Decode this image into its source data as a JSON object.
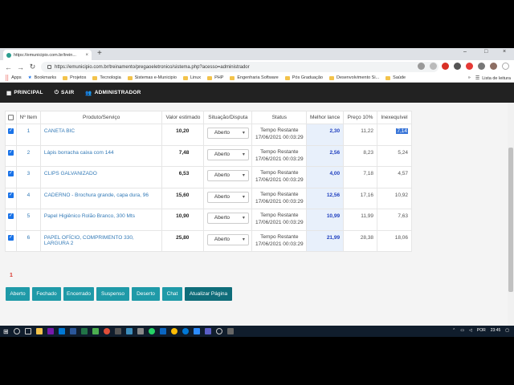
{
  "browser": {
    "tab_title": "https://emunicipio.com.br/trein...",
    "tab_close": "×",
    "new_tab": "+",
    "win_min": "–",
    "win_max": "□",
    "win_close": "×",
    "url": "https://emunicipio.com.br/treinamento/pregaoeletronico/sistema.php?acesso=administrador"
  },
  "bookmarks": {
    "items": [
      "Apps",
      "Bookmarks",
      "Projetos",
      "Tecnologia",
      "Sistemas e-Municipio",
      "Linux",
      "PHP",
      "Engenharia Software",
      "Pós Graduação",
      "Desenvolvimento Si...",
      "Saúde"
    ],
    "more": "»",
    "reading_list": "Lista de leitura"
  },
  "nav": {
    "principal": "PRINCIPAL",
    "sair": "SAIR",
    "administrador": "ADMINISTRADOR"
  },
  "table": {
    "headers": [
      "",
      "Nº Item",
      "Produto/Serviço",
      "Valor estimado",
      "Situação/Disputa",
      "Status",
      "Melhor lance",
      "Preço 10%",
      "Inexequível"
    ],
    "rows": [
      {
        "checked": true,
        "item": "1",
        "produto": "CANETA BIC",
        "valor": "10,20",
        "situacao": "Aberto",
        "status1": "Tempo Restante",
        "status2": "17/06/2021 00:03:29",
        "melhor": "2,30",
        "preco": "11,22",
        "inexeq": "7,14"
      },
      {
        "checked": true,
        "item": "2",
        "produto": "Lápis borracha caixa com 144",
        "valor": "7,48",
        "situacao": "Aberto",
        "status1": "Tempo Restante",
        "status2": "17/06/2021 00:03:29",
        "melhor": "2,56",
        "preco": "8,23",
        "inexeq": "5,24"
      },
      {
        "checked": true,
        "item": "3",
        "produto": "CLIPS GALVANIZADO",
        "valor": "6,53",
        "situacao": "Aberto",
        "status1": "Tempo Restante",
        "status2": "17/06/2021 00:03:29",
        "melhor": "4,00",
        "preco": "7,18",
        "inexeq": "4,57"
      },
      {
        "checked": true,
        "item": "4",
        "produto": "CADERNO - Brochura grande, capa dura, 96",
        "valor": "15,60",
        "situacao": "Aberto",
        "status1": "Tempo Restante",
        "status2": "17/06/2021 00:03:29",
        "melhor": "12,56",
        "preco": "17,16",
        "inexeq": "10,92"
      },
      {
        "checked": true,
        "item": "5",
        "produto": "Papel Higiênico Rolão Branco, 300 Mts",
        "valor": "10,90",
        "situacao": "Aberto",
        "status1": "Tempo Restante",
        "status2": "17/06/2021 00:03:29",
        "melhor": "10,99",
        "preco": "11,99",
        "inexeq": "7,63"
      },
      {
        "checked": true,
        "item": "6",
        "produto": "PAPEL OFÍCIO, COMPRIMENTO 330, LARGURA 2",
        "valor": "25,80",
        "situacao": "Aberto",
        "status1": "Tempo Restante",
        "status2": "17/06/2021 00:03:29",
        "melhor": "21,99",
        "preco": "28,38",
        "inexeq": "18,06"
      }
    ]
  },
  "pagination": {
    "current": "1"
  },
  "buttons": {
    "aberto": "Aberto",
    "fechado": "Fechado",
    "encerrado": "Encerrado",
    "suspenso": "Suspenso",
    "deserto": "Deserto",
    "chat": "Chat",
    "atualizar": "Atualizar Página"
  },
  "taskbar": {
    "lang": "POR",
    "time": "23:45"
  }
}
